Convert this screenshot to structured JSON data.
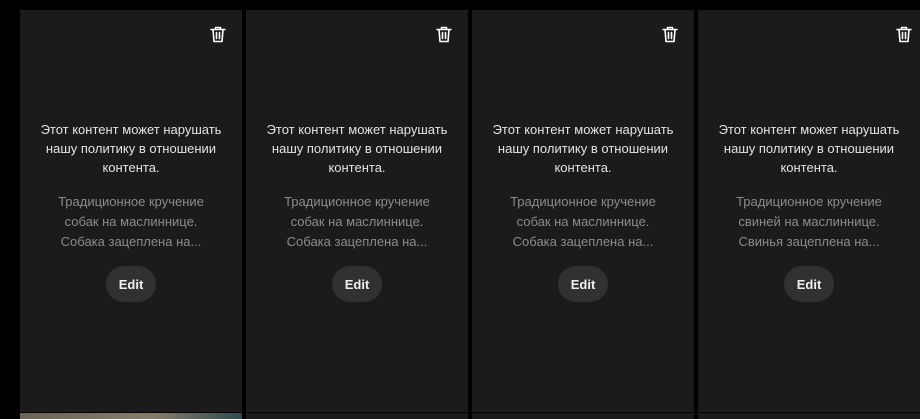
{
  "cards": [
    {
      "warning": "Этот контент может нарушать нашу политику в отношении контента.",
      "description": "Традиционное кручение собак на маслиннице. Собака зацеплена на...",
      "edit_label": "Edit",
      "delete_icon": "trash-icon"
    },
    {
      "warning": "Этот контент может нарушать нашу политику в отношении контента.",
      "description": "Традиционное кручение собак на маслиннице. Собака зацеплена на...",
      "edit_label": "Edit",
      "delete_icon": "trash-icon"
    },
    {
      "warning": "Этот контент может нарушать нашу политику в отношении контента.",
      "description": "Традиционное кручение собак на маслиннице. Собака зацеплена на...",
      "edit_label": "Edit",
      "delete_icon": "trash-icon"
    },
    {
      "warning": "Этот контент может нарушать нашу политику в отношении контента.",
      "description": "Традиционное кручение свиней на маслиннице. Свинья зацеплена на...",
      "edit_label": "Edit",
      "delete_icon": "trash-icon"
    }
  ],
  "colors": {
    "background": "#000000",
    "card": "#1b1b1b",
    "button": "#313131",
    "warning_text": "#e3e3e3",
    "description_text": "#8b8b8b"
  }
}
